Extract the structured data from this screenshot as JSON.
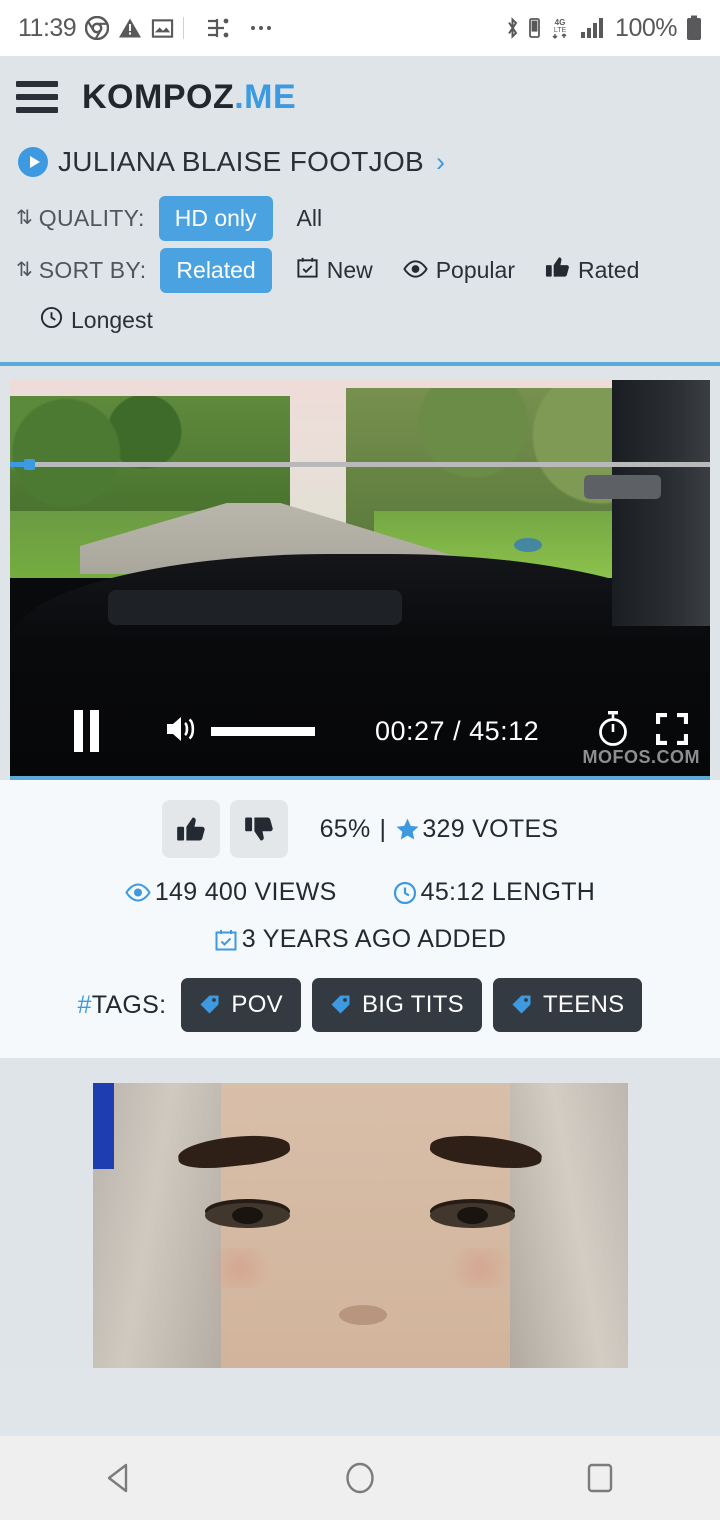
{
  "status_bar": {
    "time": "11:39",
    "battery_percent": "100%",
    "network": "4G LTE",
    "left_icons": [
      "chrome-icon",
      "warning-icon",
      "image-icon",
      "usb-debug-icon",
      "more-icon"
    ],
    "right_icons": [
      "bluetooth-icon",
      "bluetooth-battery-icon",
      "lte-icon",
      "signal-bars-icon",
      "battery-icon"
    ]
  },
  "header": {
    "menu_icon": "hamburger-icon",
    "logo_main": "KOMPOZ",
    "logo_suffix": ".ME"
  },
  "page": {
    "title": "JULIANA BLAISE FOOTJOB",
    "chevron": "›"
  },
  "filters": {
    "quality_label": "QUALITY:",
    "quality_options": [
      {
        "label": "HD only",
        "active": true
      },
      {
        "label": "All",
        "active": false
      }
    ],
    "sort_label": "SORT BY:",
    "sort_options": [
      {
        "label": "Related",
        "active": true,
        "icon": ""
      },
      {
        "label": "New",
        "active": false,
        "icon": "calendar-check-icon"
      },
      {
        "label": "Popular",
        "active": false,
        "icon": "eye-icon"
      },
      {
        "label": "Rated",
        "active": false,
        "icon": "thumbs-up-icon"
      },
      {
        "label": "Longest",
        "active": false,
        "icon": "clock-icon"
      }
    ]
  },
  "player": {
    "state": "playing",
    "pause_icon": "pause-icon",
    "volume_icon": "volume-icon",
    "current_time": "00:27",
    "total_time": "45:12",
    "time_display": "00:27 / 45:12",
    "progress_percent": 1,
    "timer_icon": "stopwatch-icon",
    "fullscreen_icon": "fullscreen-icon",
    "watermark": "MOFOS.COM"
  },
  "stats": {
    "like_icon": "thumbs-up-icon",
    "dislike_icon": "thumbs-down-icon",
    "rating_percent": "65%",
    "separator": "|",
    "star_icon": "star-icon",
    "votes": "329 VOTES",
    "views_icon": "eye-icon",
    "views": "149 400 VIEWS",
    "length_icon": "clock-icon",
    "length": "45:12 LENGTH",
    "added_icon": "calendar-check-icon",
    "added": "3 YEARS AGO ADDED"
  },
  "tags": {
    "label_hash": "#",
    "label_text": "TAGS:",
    "items": [
      "POV",
      "BIG TITS",
      "TEENS"
    ]
  },
  "next_item": {
    "thumbnail_alt": "close-up face thumbnail"
  },
  "nav_bar": {
    "back_icon": "back-triangle-icon",
    "home_icon": "home-circle-icon",
    "recents_icon": "recents-square-icon"
  },
  "colors": {
    "accent_blue": "#3d9ae0",
    "pill_blue": "#4aa2e0",
    "page_bg": "#dfe4e8",
    "panel_bg": "#f5f9fc",
    "tag_bg": "#333a41",
    "text_dark": "#232a31"
  }
}
